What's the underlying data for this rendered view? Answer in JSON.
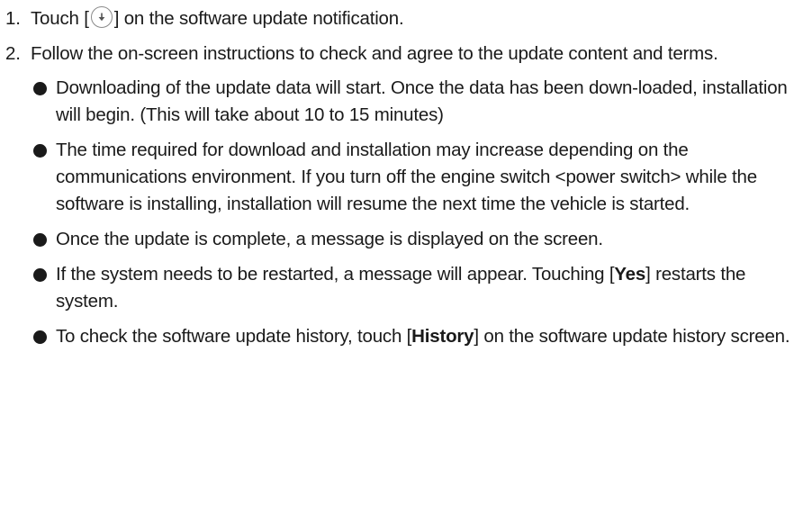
{
  "steps": [
    {
      "number": "1.",
      "text_before": "Touch [",
      "icon": "download-arrow-icon",
      "text_after": "] on the software update notification."
    },
    {
      "number": "2.",
      "text": "Follow the on-screen instructions to check and agree to the update content and terms.",
      "bullets": [
        {
          "text": "Downloading of the update data will start. Once the data has been down-loaded, installation will begin. (This will take about 10 to 15 minutes)"
        },
        {
          "text": "The time required for download and installation may increase depending on the communications environment. If you turn off the engine switch <power switch> while the software is installing, installation will resume the next time the vehicle is started."
        },
        {
          "text": "Once the update is complete, a message is displayed on the screen."
        },
        {
          "pre": "If the system needs to be restarted, a message will appear. Touching [",
          "bold": "Yes",
          "post": "] restarts the system."
        },
        {
          "pre": "To check the software update history, touch [",
          "bold": "History",
          "post": "] on the software update history screen."
        }
      ]
    }
  ]
}
